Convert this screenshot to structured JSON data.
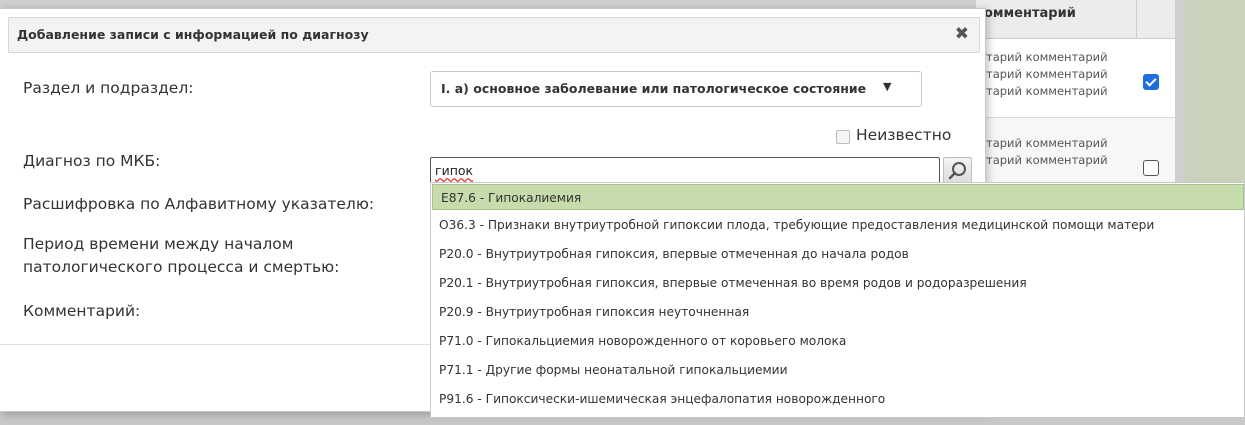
{
  "background": {
    "column_header": "омментарий",
    "row1_lines": [
      "тарий комментарий",
      "тарий комментарий",
      "тарий комментарий"
    ],
    "row2_lines": [
      "тарий комментарий",
      "тарий комментарий"
    ],
    "row1_checked": true,
    "row2_checked": false
  },
  "dialog": {
    "title": "Добавление записи с информацией по диагнозу",
    "close_glyph": "✖",
    "labels": {
      "section": "Раздел и подраздел:",
      "mkb": "Диагноз по МКБ:",
      "alphabetical": "Расшифровка по Алфавитному указателю:",
      "period_line1": "Период времени между началом",
      "period_line2": "патологического процесса и смертью:",
      "comment": "Комментарий:"
    },
    "section_select": {
      "value": "I. а) основное заболевание или патологическое состояние",
      "arrow": "▼"
    },
    "unknown_checkbox": {
      "label": "Неизвестно",
      "checked": false
    },
    "mkb_input": {
      "value": "гипок"
    },
    "search_button_icon": "search-icon"
  },
  "dropdown": {
    "selected_index": 0,
    "items": [
      "E87.6 - Гипокалиемия",
      "O36.3 - Признаки внутриутробной гипоксии плода, требующие предоставления медицинской помощи матери",
      "P20.0 - Внутриутробная гипоксия, впервые отмеченная до начала родов",
      "P20.1 - Внутриутробная гипоксия, впервые отмеченная во время родов и родоразрешения",
      "P20.9 - Внутриутробная гипоксия неуточненная",
      "P71.0 - Гипокальциемия новорожденного от коровьего молока",
      "P71.1 - Другие формы неонатальной гипокальциемии",
      "P91.6 - Гипоксически-ишемическая энцефалопатия новорожденного"
    ]
  },
  "colors": {
    "selected_item_bg": "#c7dcac",
    "checkbox_checked": "#1e6fd9"
  }
}
